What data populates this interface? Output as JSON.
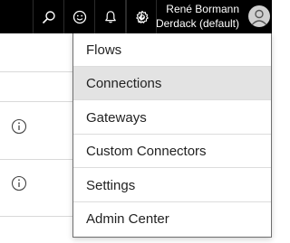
{
  "header": {
    "icons": [
      "search-icon",
      "smiley-icon",
      "bell-icon",
      "download-icon",
      "gear-icon"
    ],
    "user_name": "René Bormann",
    "org": "Derdack (default)",
    "avatar_icon": "person-icon"
  },
  "menu": {
    "items": [
      {
        "label": "Flows"
      },
      {
        "label": "Connections",
        "active": true
      },
      {
        "label": "Gateways"
      },
      {
        "label": "Custom Connectors"
      },
      {
        "label": "Settings"
      },
      {
        "label": "Admin Center"
      }
    ]
  },
  "colors": {
    "topbar_bg": "#000000",
    "menu_hover_bg": "#e3e3e3",
    "menu_border": "#6e6e6e"
  }
}
